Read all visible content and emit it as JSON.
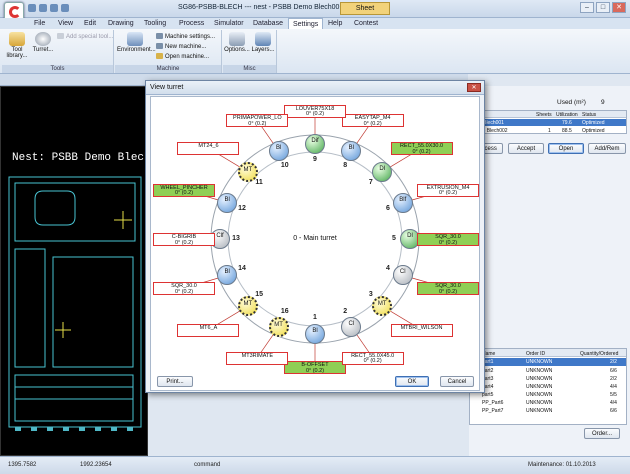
{
  "window": {
    "title": "SG86-PSBB-BLECH --- nest - PSBB Demo Blech001",
    "sheet_tab": "Sheet",
    "minimize": "–",
    "maximize": "□",
    "close": "✕"
  },
  "menu": [
    "File",
    "View",
    "Edit",
    "Drawing",
    "Tooling",
    "Process",
    "Simulator",
    "Database",
    "Settings",
    "Help",
    "Contest"
  ],
  "ribbon": {
    "tools_group": "Tools",
    "machine_group": "Machine",
    "misc_group": "Misc",
    "tool_library": "Tool library...",
    "turret": "Turret...",
    "add_special_tool": "Add special tool...",
    "environment": "Environment...",
    "machine_settings": "Machine settings...",
    "new_machine": "New machine...",
    "open_machine": "Open machine...",
    "options": "Options...",
    "layers": "Layers..."
  },
  "canvas": {
    "nest_label": "Nest: PSBB Demo Blech001  Material:"
  },
  "right_pane": {
    "nest_label": "nest",
    "used_label": "Used (m²)",
    "used_value": "9",
    "table_headers": [
      "",
      "Sheets",
      "Utilization",
      "Status"
    ],
    "table_rows": [
      [
        "emo Blech001",
        "",
        "79.6",
        "Optimized"
      ],
      [
        "Demo Blech002",
        "1",
        "88.5",
        "Optimized"
      ]
    ],
    "buttons": [
      "Process",
      "Accept",
      "Open",
      "Add/Rem"
    ],
    "order_headers": [
      "Name",
      "Order ID",
      "Quantity/Ordered"
    ],
    "order_rows": [
      [
        "part1",
        "UNKNOWN",
        "2/2"
      ],
      [
        "part2",
        "UNKNOWN",
        "6/6"
      ],
      [
        "part3",
        "UNKNOWN",
        "2/2"
      ],
      [
        "part4",
        "UNKNOWN",
        "4/4"
      ],
      [
        "part5",
        "UNKNOWN",
        "5/5"
      ],
      [
        "PP_Part6",
        "UNKNOWN",
        "4/4"
      ],
      [
        "PP_Part7",
        "UNKNOWN",
        "6/6"
      ]
    ],
    "order_button": "Order..."
  },
  "dialog": {
    "title": "View turret",
    "center_label": "0 - Main turret",
    "print": "Print...",
    "ok": "OK",
    "cancel": "Cancel",
    "stations": [
      {
        "num": "1",
        "type": "Bl",
        "tool": "B-OFFSET",
        "sub": "0° (0.2)"
      },
      {
        "num": "2",
        "type": "Cl",
        "tool": "RECT_55.0X45.0",
        "sub": "0° (0.2)"
      },
      {
        "num": "3",
        "type": "MT",
        "tool": "MTBRI_WILSON",
        "sub": ""
      },
      {
        "num": "4",
        "type": "Cl",
        "tool": "SQR_30.0",
        "sub": "0° (0.2)"
      },
      {
        "num": "5",
        "type": "Dl",
        "tool": "SQR_30.0",
        "sub": "0° (0.2)"
      },
      {
        "num": "6",
        "type": "Blf",
        "tool": "EXTRUSION_M4",
        "sub": "0° (0.2)"
      },
      {
        "num": "7",
        "type": "Dl",
        "tool": "RECT_55.0X30.0",
        "sub": "0° (0.2)"
      },
      {
        "num": "8",
        "type": "Bl",
        "tool": "EASYTAP_M4",
        "sub": "0° (0.2)"
      },
      {
        "num": "9",
        "type": "Dif",
        "tool": "LOUVER75X18",
        "sub": "0° (0.2)"
      },
      {
        "num": "10",
        "type": "Bl",
        "tool": "PRIMAPOWER_LO",
        "sub": "0° (0.2)"
      },
      {
        "num": "11",
        "type": "MT",
        "tool": "MT24_6",
        "sub": ""
      },
      {
        "num": "12",
        "type": "Bl",
        "tool": "WHEEL_PINCHER",
        "sub": "0° (0.2)"
      },
      {
        "num": "13",
        "type": "Clf",
        "tool": "C-BIGRIB",
        "sub": "0° (0.2)"
      },
      {
        "num": "14",
        "type": "Bl",
        "tool": "SQR_30.0",
        "sub": "0° (0.2)"
      },
      {
        "num": "15",
        "type": "MT",
        "tool": "MT6_A",
        "sub": ""
      },
      {
        "num": "16",
        "type": "MT",
        "tool": "MT3RIMATE",
        "sub": ""
      }
    ]
  },
  "status": {
    "x": "1395.7582",
    "y": "1992.23654",
    "mode": "command",
    "maintenance": "Maintenance: 01.10.2013"
  }
}
